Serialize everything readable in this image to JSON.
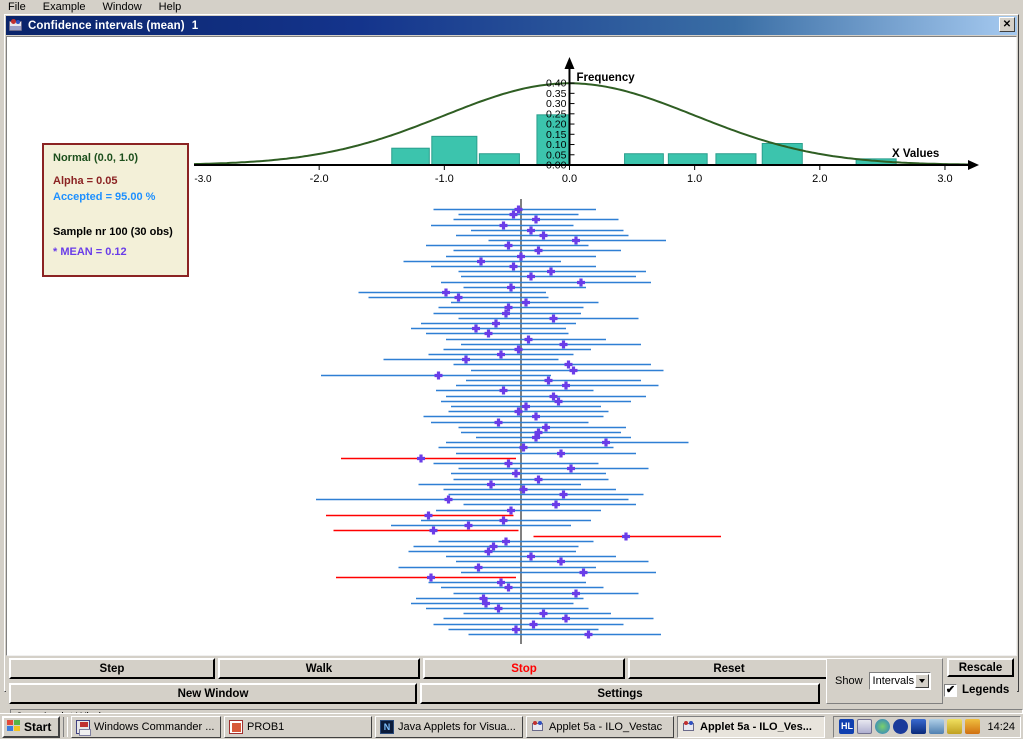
{
  "menubar": {
    "items": [
      {
        "label": "File"
      },
      {
        "label": "Example"
      },
      {
        "label": "Window"
      },
      {
        "label": "Help"
      }
    ]
  },
  "window": {
    "title": "Confidence intervals (mean)",
    "instance": "1",
    "close_label": "✕",
    "icon": "applet-icon"
  },
  "legend": {
    "distribution": "Normal (0.0, 1.0)",
    "alpha": "Alpha = 0.05",
    "accepted": "Accepted = 95.00 %",
    "sample": "Sample nr 100 (30 obs)",
    "mean": "* MEAN = 0.12",
    "colors": {
      "box_fill": "#f3f0d8",
      "box_border": "#8b2323",
      "distribution": "#1c4f1c",
      "alpha": "#8b2323",
      "accepted": "#1e90ff",
      "sample": "#000000",
      "mean": "#6a3de8"
    }
  },
  "controls": {
    "step": "Step",
    "walk": "Walk",
    "stop": "Stop",
    "reset": "Reset",
    "new_window": "New Window",
    "settings": "Settings",
    "show_label": "Show",
    "show_value": "Intervals",
    "show_options": [
      "Intervals"
    ],
    "rescale": "Rescale",
    "legends": "Legends",
    "legends_checked": "✔",
    "stop_color": "#ff0000"
  },
  "statusbar": {
    "text": "Java Applet Window"
  },
  "taskbar": {
    "start": "Start",
    "items": [
      {
        "label": "Windows Commander ...",
        "icon": "floppy-icon",
        "active": false
      },
      {
        "label": "PROB1",
        "icon": "document-icon",
        "active": false
      },
      {
        "label": "Java Applets for Visua...",
        "icon": "netscape-icon",
        "active": false
      },
      {
        "label": "Applet 5a - ILO_Vestac",
        "icon": "java-icon",
        "active": false
      },
      {
        "label": "Applet 5a - ILO_Ves...",
        "icon": "java-icon",
        "active": true
      }
    ],
    "tray_icons": [
      "hl-icon",
      "java-icon",
      "globe-icon",
      "media-icon",
      "display-icon",
      "network-icon",
      "pencil-icon",
      "comet-icon"
    ],
    "time": "14:24"
  },
  "chart_data": {
    "type": "histogram-with-intervals",
    "title": "",
    "histogram": {
      "type": "bar",
      "xlabel": "X Values",
      "ylabel": "Frequency",
      "xlim": [
        -3.0,
        3.2
      ],
      "ylim": [
        0.0,
        0.42
      ],
      "xticks": [
        -2.0,
        -1.0,
        0.0,
        1.0,
        2.0,
        3.0
      ],
      "xticklabels": [
        "-2.0",
        "-1.0",
        "0.0",
        "1.0",
        "2.0",
        "3.0"
      ],
      "yticks": [
        0.0,
        0.05,
        0.1,
        0.15,
        0.2,
        0.25,
        0.3,
        0.35,
        0.4
      ],
      "yticklabels": [
        "0.00",
        "0.05",
        "0.10",
        "0.15",
        "0.20",
        "0.25",
        "0.30",
        "0.35",
        "0.40"
      ],
      "extra_xticklabel": "-3.0",
      "bar_color": "#3cc4ad",
      "bar_edge": "#2a9e8c",
      "bins": [
        {
          "x0": -1.42,
          "x1": -1.12,
          "height": 0.082
        },
        {
          "x0": -1.1,
          "x1": -0.74,
          "height": 0.14
        },
        {
          "x0": -0.72,
          "x1": -0.4,
          "height": 0.055
        },
        {
          "x0": -0.26,
          "x1": 0.0,
          "height": 0.245
        },
        {
          "x0": 0.44,
          "x1": 0.75,
          "height": 0.055
        },
        {
          "x0": 0.79,
          "x1": 1.1,
          "height": 0.055
        },
        {
          "x0": 1.17,
          "x1": 1.49,
          "height": 0.055
        },
        {
          "x0": 1.54,
          "x1": 1.86,
          "height": 0.105
        },
        {
          "x0": 2.29,
          "x1": 2.61,
          "height": 0.03
        }
      ],
      "density_curve": {
        "name": "Normal (0.0, 1.0) pdf",
        "color": "#2f5e23",
        "mu": 0.0,
        "sigma": 1.0,
        "peak": 0.3989
      }
    },
    "intervals": {
      "type": "errorbar",
      "reference_line": 0.0,
      "reference_color": "#808080",
      "accepted_color": "#2e7fd4",
      "rejected_color": "#ff0000",
      "marker_color": "#6a3de8",
      "count": 100,
      "rejected_count": 5,
      "xlim": [
        -1.05,
        1.05
      ],
      "data": [
        {
          "lo": -0.35,
          "mean": -0.01,
          "hi": 0.3,
          "rejected": false
        },
        {
          "lo": -0.25,
          "mean": -0.03,
          "hi": 0.23,
          "rejected": false
        },
        {
          "lo": -0.27,
          "mean": 0.06,
          "hi": 0.39,
          "rejected": false
        },
        {
          "lo": -0.36,
          "mean": -0.07,
          "hi": 0.21,
          "rejected": false
        },
        {
          "lo": -0.2,
          "mean": 0.04,
          "hi": 0.41,
          "rejected": false
        },
        {
          "lo": -0.26,
          "mean": 0.09,
          "hi": 0.43,
          "rejected": false
        },
        {
          "lo": -0.13,
          "mean": 0.22,
          "hi": 0.58,
          "rejected": false
        },
        {
          "lo": -0.38,
          "mean": -0.05,
          "hi": 0.27,
          "rejected": false
        },
        {
          "lo": -0.27,
          "mean": 0.07,
          "hi": 0.4,
          "rejected": false
        },
        {
          "lo": -0.3,
          "mean": 0.0,
          "hi": 0.3,
          "rejected": false
        },
        {
          "lo": -0.47,
          "mean": -0.16,
          "hi": 0.16,
          "rejected": false
        },
        {
          "lo": -0.36,
          "mean": -0.03,
          "hi": 0.3,
          "rejected": false
        },
        {
          "lo": -0.25,
          "mean": 0.12,
          "hi": 0.5,
          "rejected": false
        },
        {
          "lo": -0.24,
          "mean": 0.04,
          "hi": 0.46,
          "rejected": false
        },
        {
          "lo": -0.32,
          "mean": 0.24,
          "hi": 0.52,
          "rejected": false
        },
        {
          "lo": -0.23,
          "mean": -0.04,
          "hi": 0.26,
          "rejected": false
        },
        {
          "lo": -0.65,
          "mean": -0.3,
          "hi": 0.1,
          "rejected": false
        },
        {
          "lo": -0.61,
          "mean": -0.25,
          "hi": 0.11,
          "rejected": false
        },
        {
          "lo": -0.28,
          "mean": 0.02,
          "hi": 0.31,
          "rejected": false
        },
        {
          "lo": -0.33,
          "mean": -0.05,
          "hi": 0.25,
          "rejected": false
        },
        {
          "lo": -0.35,
          "mean": -0.06,
          "hi": 0.24,
          "rejected": false
        },
        {
          "lo": -0.25,
          "mean": 0.13,
          "hi": 0.47,
          "rejected": false
        },
        {
          "lo": -0.4,
          "mean": -0.1,
          "hi": 0.22,
          "rejected": false
        },
        {
          "lo": -0.44,
          "mean": -0.18,
          "hi": 0.18,
          "rejected": false
        },
        {
          "lo": -0.38,
          "mean": -0.13,
          "hi": 0.19,
          "rejected": false
        },
        {
          "lo": -0.3,
          "mean": 0.03,
          "hi": 0.34,
          "rejected": false
        },
        {
          "lo": -0.24,
          "mean": 0.17,
          "hi": 0.48,
          "rejected": false
        },
        {
          "lo": -0.31,
          "mean": -0.01,
          "hi": 0.28,
          "rejected": false
        },
        {
          "lo": -0.37,
          "mean": -0.08,
          "hi": 0.21,
          "rejected": false
        },
        {
          "lo": -0.55,
          "mean": -0.22,
          "hi": 0.15,
          "rejected": false
        },
        {
          "lo": -0.27,
          "mean": 0.19,
          "hi": 0.52,
          "rejected": false
        },
        {
          "lo": -0.2,
          "mean": 0.21,
          "hi": 0.57,
          "rejected": false
        },
        {
          "lo": -0.8,
          "mean": -0.33,
          "hi": 0.12,
          "rejected": false
        },
        {
          "lo": -0.22,
          "mean": 0.11,
          "hi": 0.48,
          "rejected": false
        },
        {
          "lo": -0.26,
          "mean": 0.18,
          "hi": 0.55,
          "rejected": false
        },
        {
          "lo": -0.34,
          "mean": -0.07,
          "hi": 0.29,
          "rejected": false
        },
        {
          "lo": -0.3,
          "mean": 0.13,
          "hi": 0.5,
          "rejected": false
        },
        {
          "lo": -0.32,
          "mean": 0.15,
          "hi": 0.44,
          "rejected": false
        },
        {
          "lo": -0.28,
          "mean": 0.02,
          "hi": 0.32,
          "rejected": false
        },
        {
          "lo": -0.29,
          "mean": -0.01,
          "hi": 0.35,
          "rejected": false
        },
        {
          "lo": -0.39,
          "mean": 0.06,
          "hi": 0.33,
          "rejected": false
        },
        {
          "lo": -0.36,
          "mean": -0.09,
          "hi": 0.27,
          "rejected": false
        },
        {
          "lo": -0.25,
          "mean": 0.1,
          "hi": 0.42,
          "rejected": false
        },
        {
          "lo": -0.24,
          "mean": 0.07,
          "hi": 0.4,
          "rejected": false
        },
        {
          "lo": -0.18,
          "mean": 0.06,
          "hi": 0.44,
          "rejected": false
        },
        {
          "lo": -0.3,
          "mean": 0.34,
          "hi": 0.67,
          "rejected": false
        },
        {
          "lo": -0.33,
          "mean": 0.01,
          "hi": 0.37,
          "rejected": false
        },
        {
          "lo": -0.26,
          "mean": 0.16,
          "hi": 0.46,
          "rejected": false
        },
        {
          "lo": -0.72,
          "mean": -0.4,
          "hi": -0.02,
          "rejected": true
        },
        {
          "lo": -0.35,
          "mean": -0.05,
          "hi": 0.31,
          "rejected": false
        },
        {
          "lo": -0.25,
          "mean": 0.2,
          "hi": 0.51,
          "rejected": false
        },
        {
          "lo": -0.28,
          "mean": -0.02,
          "hi": 0.34,
          "rejected": false
        },
        {
          "lo": -0.27,
          "mean": 0.07,
          "hi": 0.35,
          "rejected": false
        },
        {
          "lo": -0.41,
          "mean": -0.12,
          "hi": 0.24,
          "rejected": false
        },
        {
          "lo": -0.31,
          "mean": 0.01,
          "hi": 0.38,
          "rejected": false
        },
        {
          "lo": -0.29,
          "mean": 0.17,
          "hi": 0.49,
          "rejected": false
        },
        {
          "lo": -0.82,
          "mean": -0.29,
          "hi": 0.43,
          "rejected": false
        },
        {
          "lo": -0.23,
          "mean": 0.14,
          "hi": 0.46,
          "rejected": false
        },
        {
          "lo": -0.34,
          "mean": -0.04,
          "hi": 0.32,
          "rejected": false
        },
        {
          "lo": -0.78,
          "mean": -0.37,
          "hi": -0.03,
          "rejected": true
        },
        {
          "lo": -0.4,
          "mean": -0.07,
          "hi": 0.28,
          "rejected": false
        },
        {
          "lo": -0.52,
          "mean": -0.21,
          "hi": 0.2,
          "rejected": false
        },
        {
          "lo": -0.75,
          "mean": -0.35,
          "hi": -0.01,
          "rejected": true
        },
        {
          "lo": 0.05,
          "mean": 0.42,
          "hi": 0.8,
          "rejected": true
        },
        {
          "lo": -0.33,
          "mean": -0.06,
          "hi": 0.29,
          "rejected": false
        },
        {
          "lo": -0.43,
          "mean": -0.11,
          "hi": 0.23,
          "rejected": false
        },
        {
          "lo": -0.45,
          "mean": -0.13,
          "hi": 0.22,
          "rejected": false
        },
        {
          "lo": -0.3,
          "mean": 0.04,
          "hi": 0.38,
          "rejected": false
        },
        {
          "lo": -0.26,
          "mean": 0.16,
          "hi": 0.51,
          "rejected": false
        },
        {
          "lo": -0.49,
          "mean": -0.17,
          "hi": 0.3,
          "rejected": false
        },
        {
          "lo": -0.24,
          "mean": 0.25,
          "hi": 0.54,
          "rejected": false
        },
        {
          "lo": -0.74,
          "mean": -0.36,
          "hi": -0.02,
          "rejected": true
        },
        {
          "lo": -0.37,
          "mean": -0.08,
          "hi": 0.26,
          "rejected": false
        },
        {
          "lo": -0.32,
          "mean": -0.05,
          "hi": 0.33,
          "rejected": false
        },
        {
          "lo": -0.27,
          "mean": 0.22,
          "hi": 0.47,
          "rejected": false
        },
        {
          "lo": -0.42,
          "mean": -0.15,
          "hi": 0.25,
          "rejected": false
        },
        {
          "lo": -0.44,
          "mean": -0.14,
          "hi": 0.21,
          "rejected": false
        },
        {
          "lo": -0.38,
          "mean": -0.09,
          "hi": 0.27,
          "rejected": false
        },
        {
          "lo": -0.23,
          "mean": 0.09,
          "hi": 0.36,
          "rejected": false
        },
        {
          "lo": -0.31,
          "mean": 0.18,
          "hi": 0.53,
          "rejected": false
        },
        {
          "lo": -0.35,
          "mean": 0.05,
          "hi": 0.41,
          "rejected": false
        },
        {
          "lo": -0.29,
          "mean": -0.02,
          "hi": 0.31,
          "rejected": false
        },
        {
          "lo": -0.21,
          "mean": 0.27,
          "hi": 0.56,
          "rejected": false
        }
      ]
    }
  }
}
